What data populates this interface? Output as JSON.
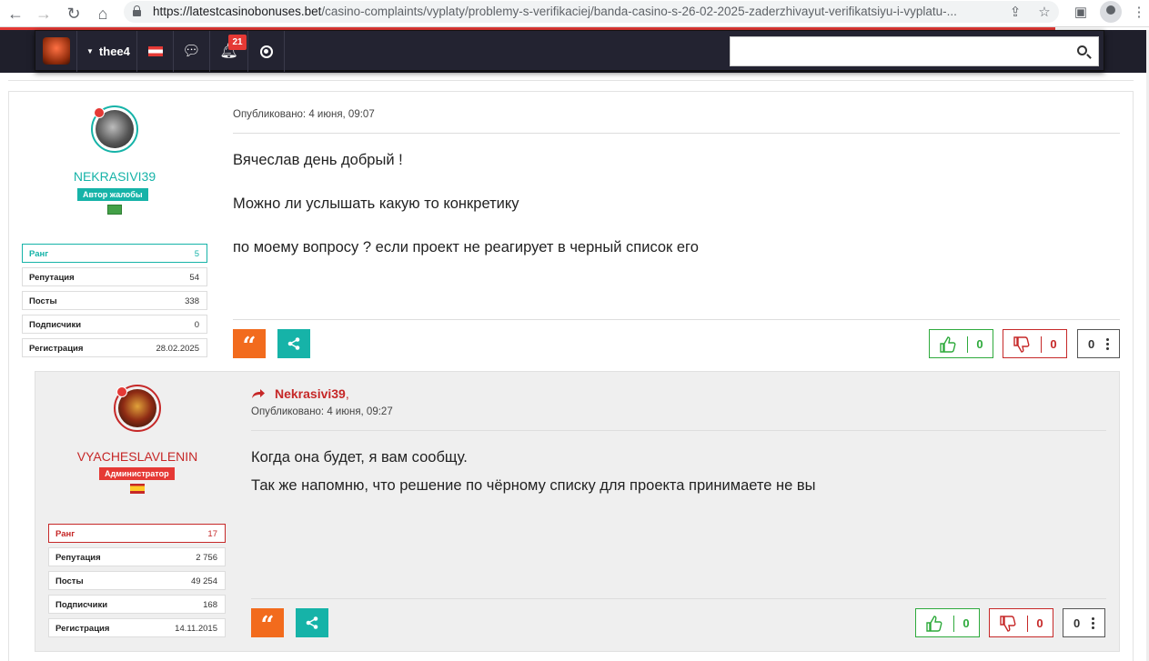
{
  "browser": {
    "url_host": "https://latestcasinobonuses.bet",
    "url_path": "/casino-complaints/vyplaty/problemy-s-verifikaciej/banda-casino-s-26-02-2025-zaderzhivayut-verifikatsiyu-i-vyplatu-..."
  },
  "header": {
    "username": "thee4",
    "notifications_count": "21",
    "search_placeholder": ""
  },
  "post": {
    "author": {
      "name": "NEKRASIVI39",
      "role": "Автор жалобы",
      "stats": [
        {
          "label": "Ранг",
          "value": "5"
        },
        {
          "label": "Репутация",
          "value": "54"
        },
        {
          "label": "Посты",
          "value": "338"
        },
        {
          "label": "Подписчики",
          "value": "0"
        },
        {
          "label": "Регистрация",
          "value": "28.02.2025"
        }
      ]
    },
    "published": "Опубликовано: 4 июня, 09:07",
    "paragraphs": [
      "Вячеслав день добрый !",
      "Можно ли услышать какую то конкретику",
      "по моему вопросу ? если проект не реагирует в черный список его"
    ],
    "likes": "0",
    "dislikes": "0",
    "more_count": "0"
  },
  "reply": {
    "author": {
      "name": "VYACHESLAVLENIN",
      "role": "Администратор",
      "stats": [
        {
          "label": "Ранг",
          "value": "17"
        },
        {
          "label": "Репутация",
          "value": "2 756"
        },
        {
          "label": "Посты",
          "value": "49 254"
        },
        {
          "label": "Подписчики",
          "value": "168"
        },
        {
          "label": "Регистрация",
          "value": "14.11.2015"
        }
      ]
    },
    "reply_to": "Nekrasivi39",
    "reply_to_suffix": ",",
    "published": "Опубликовано: 4 июня, 09:27",
    "paragraphs": [
      "Когда она будет, я вам сообщу.",
      "Так же напомню, что решение по чёрному списку для проекта принимаете не вы"
    ],
    "likes": "0",
    "dislikes": "0",
    "more_count": "0"
  },
  "colors": {
    "accent_teal": "#16b3a8",
    "accent_red": "#c62828",
    "quote_orange": "#f26b1d",
    "like_green": "#2eaa3c"
  },
  "icons": [
    "back-icon",
    "forward-icon",
    "reload-icon",
    "home-icon",
    "lock-icon",
    "share-page-icon",
    "star-icon",
    "sidebar-icon",
    "profile-icon",
    "menu-icon",
    "chat-icon",
    "bell-icon",
    "circle-icon",
    "search-icon",
    "quote-icon",
    "share-icon",
    "thumbs-up-icon",
    "thumbs-down-icon",
    "more-icon",
    "reply-arrow-icon"
  ]
}
